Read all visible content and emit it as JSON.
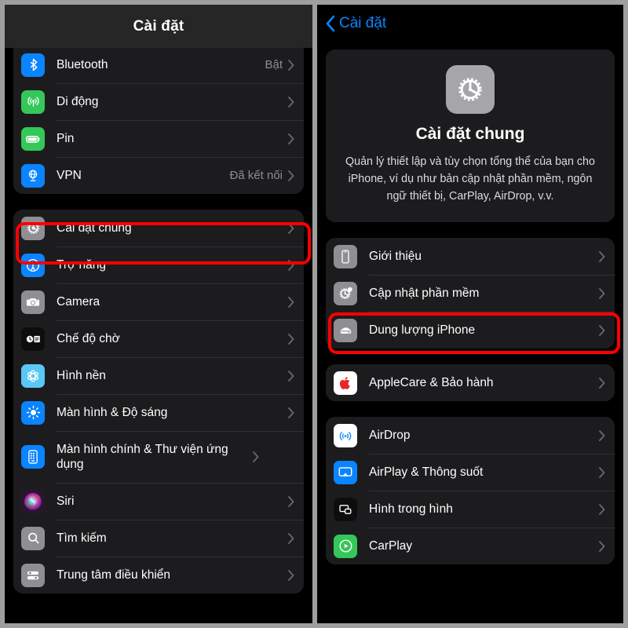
{
  "meta": {
    "accent_blue": "#0a84ff",
    "highlight_red": "#ff0000",
    "card_bg": "#1c1c1e",
    "page_bg": "#000000"
  },
  "left_panel": {
    "navbar": {
      "title": "Cài đặt"
    },
    "groups": [
      {
        "items": [
          {
            "label": "Bluetooth",
            "value": "Bật",
            "icon": "bluetooth-icon",
            "icon_bg": "#0a84ff"
          },
          {
            "label": "Di động",
            "value": "",
            "icon": "cellular-icon",
            "icon_bg": "#34c759"
          },
          {
            "label": "Pin",
            "value": "",
            "icon": "battery-icon",
            "icon_bg": "#34c759"
          },
          {
            "label": "VPN",
            "value": "Đã kết nối",
            "icon": "vpn-globe-icon",
            "icon_bg": "#0a84ff"
          }
        ]
      },
      {
        "items": [
          {
            "label": "Cài đặt chung",
            "value": "",
            "icon": "gear-icon",
            "icon_bg": "#8e8e93",
            "highlighted": true
          },
          {
            "label": "Trợ năng",
            "value": "",
            "icon": "accessibility-icon",
            "icon_bg": "#0a84ff"
          },
          {
            "label": "Camera",
            "value": "",
            "icon": "camera-icon",
            "icon_bg": "#8e8e93"
          },
          {
            "label": "Chế độ chờ",
            "value": "",
            "icon": "standby-icon",
            "icon_bg": "#0d0d0d"
          },
          {
            "label": "Hình nền",
            "value": "",
            "icon": "wallpaper-icon",
            "icon_bg": "#5ac8f5"
          },
          {
            "label": "Màn hình & Độ sáng",
            "value": "",
            "icon": "brightness-icon",
            "icon_bg": "#0a84ff"
          },
          {
            "label": "Màn hình chính & Thư viện ứng dụng",
            "value": "",
            "icon": "homescreen-icon",
            "icon_bg": "#0a84ff",
            "tall": true
          },
          {
            "label": "Siri",
            "value": "",
            "icon": "siri-icon",
            "icon_bg": "#2b1430"
          },
          {
            "label": "Tìm kiếm",
            "value": "",
            "icon": "search-icon",
            "icon_bg": "#8e8e93"
          },
          {
            "label": "Trung tâm điều khiển",
            "value": "",
            "icon": "control-center-icon",
            "icon_bg": "#8e8e93"
          }
        ]
      }
    ]
  },
  "right_panel": {
    "navbar": {
      "back_label": "Cài đặt"
    },
    "hero": {
      "icon": "gear-icon",
      "title": "Cài đặt chung",
      "description": "Quản lý thiết lập và tùy chọn tổng thể của bạn cho iPhone, ví dụ như bản cập nhật phần mềm, ngôn ngữ thiết bị, CarPlay, AirDrop, v.v."
    },
    "groups": [
      {
        "items": [
          {
            "label": "Giới thiệu",
            "icon": "iphone-info-icon",
            "icon_bg": "#8e8e93"
          },
          {
            "label": "Cập nhật phần mềm",
            "icon": "software-update-icon",
            "icon_bg": "#8e8e93",
            "highlighted": true
          },
          {
            "label": "Dung lượng iPhone",
            "icon": "storage-icon",
            "icon_bg": "#8e8e93"
          }
        ]
      },
      {
        "items": [
          {
            "label": "AppleCare & Bảo hành",
            "icon": "apple-logo-icon",
            "icon_bg": "#ffffff"
          }
        ]
      },
      {
        "items": [
          {
            "label": "AirDrop",
            "icon": "airdrop-icon",
            "icon_bg": "#ffffff"
          },
          {
            "label": "AirPlay & Thông suốt",
            "icon": "airplay-icon",
            "icon_bg": "#0a84ff"
          },
          {
            "label": "Hình trong hình",
            "icon": "pip-icon",
            "icon_bg": "#0d0d0d"
          },
          {
            "label": "CarPlay",
            "icon": "carplay-icon",
            "icon_bg": "#34c759"
          }
        ]
      }
    ]
  }
}
